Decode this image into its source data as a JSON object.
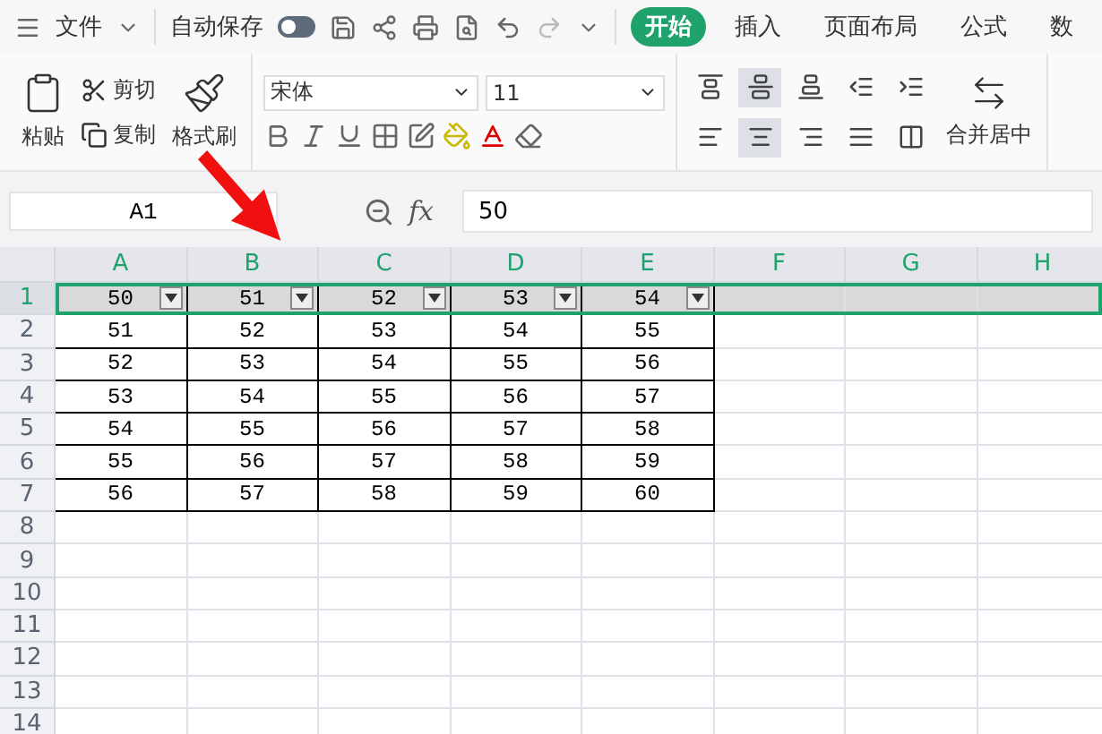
{
  "title_bar": {
    "file_menu": "文件",
    "autosave_label": "自动保存",
    "autosave_on": false,
    "tabs": [
      {
        "label": "开始",
        "selected": true
      },
      {
        "label": "插入",
        "selected": false
      },
      {
        "label": "页面布局",
        "selected": false
      },
      {
        "label": "公式",
        "selected": false
      },
      {
        "label": "数",
        "selected": false
      }
    ]
  },
  "ribbon": {
    "paste": "粘贴",
    "cut": "剪切",
    "copy": "复制",
    "format_painter": "格式刷",
    "font": "宋体",
    "font_size": "11",
    "merge": "合并居中",
    "vertical_align": [
      {
        "kind": "top",
        "selected": false
      },
      {
        "kind": "middle",
        "selected": true
      },
      {
        "kind": "bottom",
        "selected": false
      },
      {
        "kind": "outdent",
        "selected": false
      },
      {
        "kind": "indent",
        "selected": false
      }
    ],
    "horizontal_align": [
      {
        "kind": "left",
        "selected": false
      },
      {
        "kind": "center",
        "selected": true
      },
      {
        "kind": "right",
        "selected": false
      },
      {
        "kind": "justify",
        "selected": false
      },
      {
        "kind": "distribute",
        "selected": false
      }
    ]
  },
  "formula_bar": {
    "name_box": "A1",
    "fx_label": "fx",
    "value": "50"
  },
  "sheet": {
    "columns": [
      "A",
      "B",
      "C",
      "D",
      "E",
      "F",
      "G",
      "H"
    ],
    "rows": [
      {
        "number": "1",
        "selected": true,
        "filter": true,
        "cells": [
          "50",
          "51",
          "52",
          "53",
          "54"
        ]
      },
      {
        "number": "2",
        "selected": false,
        "filter": false,
        "cells": [
          "51",
          "52",
          "53",
          "54",
          "55"
        ]
      },
      {
        "number": "3",
        "selected": false,
        "filter": false,
        "cells": [
          "52",
          "53",
          "54",
          "55",
          "56"
        ]
      },
      {
        "number": "4",
        "selected": false,
        "filter": false,
        "cells": [
          "53",
          "54",
          "55",
          "56",
          "57"
        ]
      },
      {
        "number": "5",
        "selected": false,
        "filter": false,
        "cells": [
          "54",
          "55",
          "56",
          "57",
          "58"
        ]
      },
      {
        "number": "6",
        "selected": false,
        "filter": false,
        "cells": [
          "55",
          "56",
          "57",
          "58",
          "59"
        ]
      },
      {
        "number": "7",
        "selected": false,
        "filter": false,
        "cells": [
          "56",
          "57",
          "58",
          "59",
          "60"
        ]
      },
      {
        "number": "8",
        "selected": false,
        "filter": false
      },
      {
        "number": "9",
        "selected": false,
        "filter": false
      },
      {
        "number": "10",
        "selected": false,
        "filter": false
      },
      {
        "number": "11",
        "selected": false,
        "filter": false
      },
      {
        "number": "12",
        "selected": false,
        "filter": false
      },
      {
        "number": "13",
        "selected": false,
        "filter": false
      },
      {
        "number": "14",
        "selected": false,
        "filter": false
      }
    ]
  }
}
